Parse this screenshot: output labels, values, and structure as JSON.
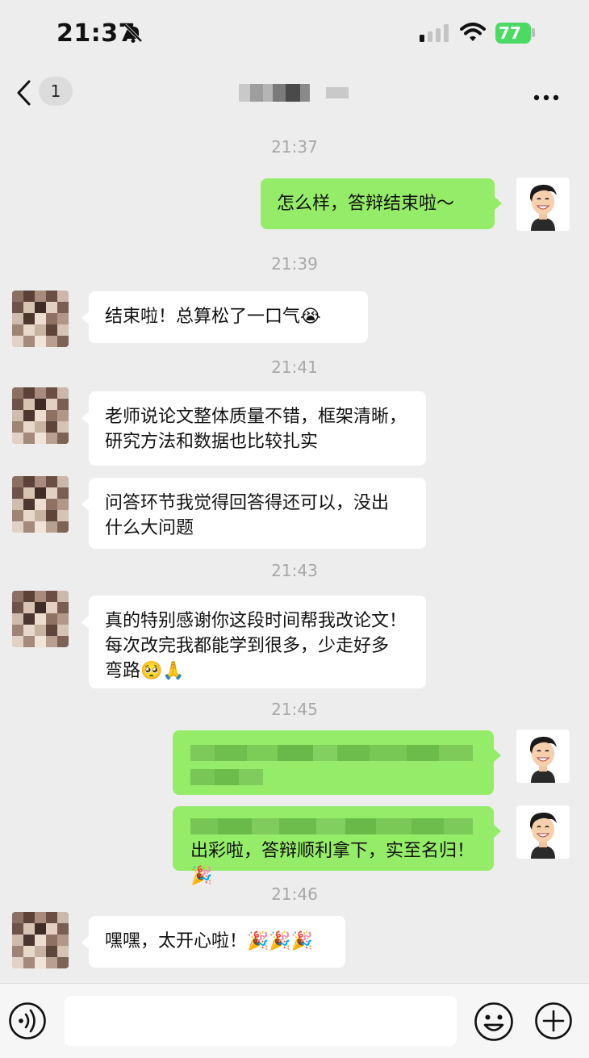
{
  "status_bar": {
    "time": "21:37",
    "battery": "77"
  },
  "nav": {
    "unread_count": "1",
    "more_label": "···"
  },
  "timestamps": [
    "21:37",
    "21:39",
    "21:41",
    "21:43",
    "21:45",
    "21:46"
  ],
  "messages": [
    {
      "text": "怎么样，答辩结束啦～"
    },
    {
      "text": "结束啦！总算松了一口气😭"
    },
    {
      "line1": "老师说论文整体质量不错，框架清晰，",
      "line2": "研究方法和数据也比较扎实"
    },
    {
      "line1": "问答环节我觉得回答得还可以，没出",
      "line2": "什么大问题"
    },
    {
      "line1": "真的特别感谢你这段时间帮我改论文！",
      "line2": "每次改完我都能学到很多，少走好多",
      "line3": "弯路🥺🙏"
    },
    {
      "line2": "出彩啦，答辩顺利拿下，实至名归！🎉"
    },
    {
      "text": "嘿嘿，太开心啦！🎉🎉🎉"
    }
  ],
  "icons": [
    "mute-bell-icon",
    "signal-icon",
    "wifi-icon",
    "battery-icon",
    "back-chevron-icon",
    "more-icon",
    "voice-icon",
    "emoji-icon",
    "plus-icon"
  ],
  "colors": {
    "outgoing_bubble": "#95ec69",
    "incoming_bubble": "#ffffff",
    "background": "#ededed",
    "battery": "#4cd964"
  }
}
